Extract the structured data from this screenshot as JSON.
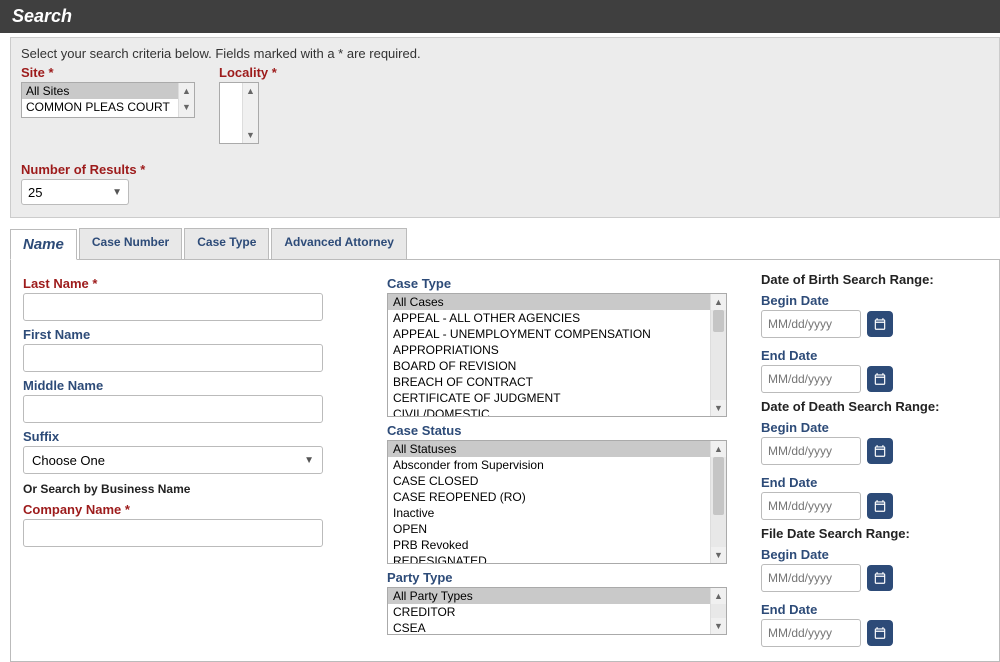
{
  "header": {
    "title": "Search"
  },
  "instruction": "Select your search criteria below. Fields marked with a * are required.",
  "site": {
    "label": "Site",
    "options": [
      "All Sites",
      "COMMON PLEAS COURT"
    ],
    "selected": "All Sites"
  },
  "locality": {
    "label": "Locality"
  },
  "numResults": {
    "label": "Number of Results",
    "value": "25"
  },
  "tabs": [
    {
      "label": "Name",
      "active": true
    },
    {
      "label": "Case Number",
      "active": false
    },
    {
      "label": "Case Type",
      "active": false
    },
    {
      "label": "Advanced Attorney",
      "active": false
    }
  ],
  "nameForm": {
    "lastName": {
      "label": "Last Name"
    },
    "firstName": {
      "label": "First Name"
    },
    "middleName": {
      "label": "Middle Name"
    },
    "suffix": {
      "label": "Suffix",
      "value": "Choose One"
    },
    "orSearch": "Or Search by Business Name",
    "companyName": {
      "label": "Company Name"
    }
  },
  "caseType": {
    "label": "Case Type",
    "options": [
      "All Cases",
      "APPEAL - ALL OTHER AGENCIES",
      "APPEAL - UNEMPLOYMENT COMPENSATION",
      "APPROPRIATIONS",
      "BOARD OF REVISION",
      "BREACH OF CONTRACT",
      "CERTIFICATE OF JUDGMENT",
      "CIVIL/DOMESTIC"
    ]
  },
  "caseStatus": {
    "label": "Case Status",
    "options": [
      "All Statuses",
      "Absconder from Supervision",
      "CASE CLOSED",
      "CASE REOPENED (RO)",
      "Inactive",
      "OPEN",
      "PRB Revoked",
      "REDESIGNATED"
    ]
  },
  "partyType": {
    "label": "Party Type",
    "options": [
      "All Party Types",
      "CREDITOR",
      "CSEA"
    ]
  },
  "dob": {
    "header": "Date of Birth Search Range:",
    "begin": "Begin Date",
    "end": "End Date"
  },
  "dod": {
    "header": "Date of Death Search Range:",
    "begin": "Begin Date",
    "end": "End Date"
  },
  "fileDate": {
    "header": "File Date Search Range:",
    "begin": "Begin Date",
    "end": "End Date"
  },
  "datePlaceholder": "MM/dd/yyyy"
}
